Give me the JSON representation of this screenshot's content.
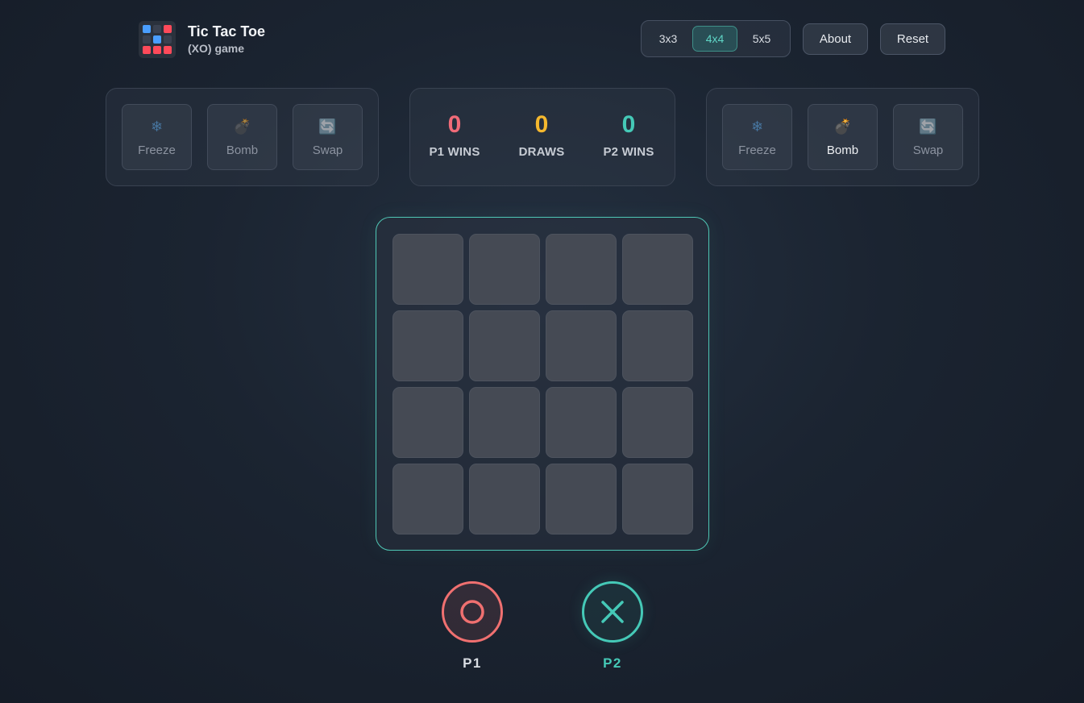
{
  "header": {
    "title": "Tic Tac Toe",
    "subtitle": "(XO) game",
    "logo_colors": [
      "#4a9eff",
      "#3a4150",
      "#ff4a5a",
      "#3a4150",
      "#4a9eff",
      "#3a4150",
      "#ff4a5a",
      "#ff4a5a",
      "#ff4a5a"
    ]
  },
  "board_sizes": [
    {
      "label": "3x3",
      "active": false
    },
    {
      "label": "4x4",
      "active": true
    },
    {
      "label": "5x5",
      "active": false
    }
  ],
  "toolbar": {
    "about_label": "About",
    "reset_label": "Reset"
  },
  "p1_powers": [
    {
      "label": "Freeze",
      "icon": "snowflake-icon",
      "glyph": "❄",
      "enabled": false
    },
    {
      "label": "Bomb",
      "icon": "bomb-icon",
      "glyph": "💣",
      "enabled": false
    },
    {
      "label": "Swap",
      "icon": "swap-icon",
      "glyph": "🔄",
      "enabled": false
    }
  ],
  "p2_powers": [
    {
      "label": "Freeze",
      "icon": "snowflake-icon",
      "glyph": "❄",
      "enabled": false
    },
    {
      "label": "Bomb",
      "icon": "bomb-icon",
      "glyph": "💣",
      "enabled": true
    },
    {
      "label": "Swap",
      "icon": "swap-icon",
      "glyph": "🔄",
      "enabled": false
    }
  ],
  "scores": {
    "p1": {
      "value": "0",
      "label": "P1 WINS",
      "color": "#f06b78"
    },
    "draws": {
      "value": "0",
      "label": "DRAWS",
      "color": "#f5b82e"
    },
    "p2": {
      "value": "0",
      "label": "P2 WINS",
      "color": "#45c9b7"
    }
  },
  "board": {
    "rows": 4,
    "cols": 4,
    "cells": [
      "",
      "",
      "",
      "",
      "",
      "",
      "",
      "",
      "",
      "",
      "",
      "",
      "",
      "",
      "",
      ""
    ]
  },
  "players": {
    "p1": {
      "label": "P1",
      "symbol": "O",
      "color": "#f07070",
      "label_color": "#d9dde3"
    },
    "p2": {
      "label": "P2",
      "symbol": "X",
      "color": "#45c9b7",
      "label_color": "#45c9b7",
      "active": true
    }
  }
}
